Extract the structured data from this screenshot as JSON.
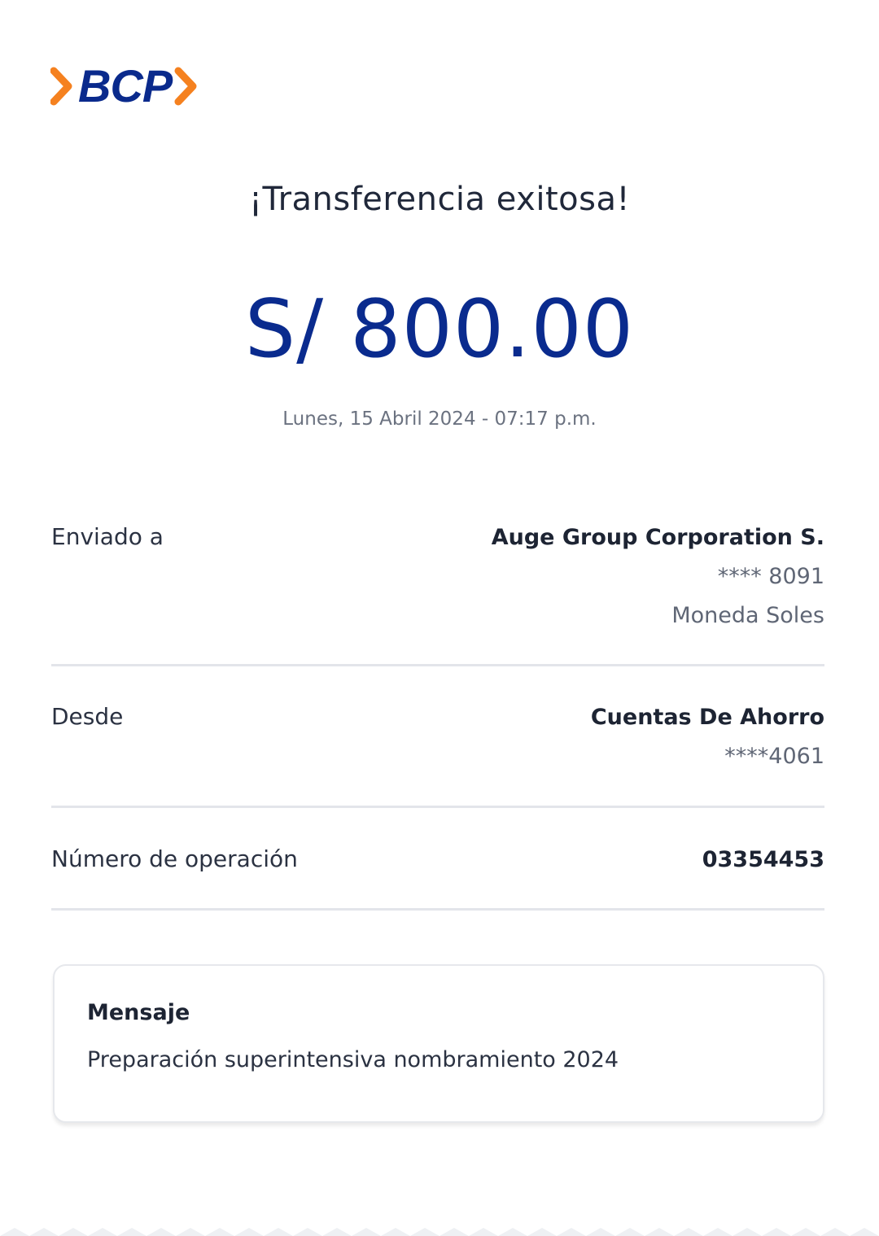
{
  "brand": {
    "name": "BCP",
    "primary_color": "#0a2a8c",
    "accent_color": "#f5811f"
  },
  "header": {
    "title": "¡Transferencia exitosa!"
  },
  "transfer": {
    "amount": "S/ 800.00",
    "datetime": "Lunes, 15 Abril 2024 - 07:17 p.m."
  },
  "sent_to": {
    "label": "Enviado a",
    "name": "Auge Group Corporation S.",
    "account": "**** 8091",
    "currency": "Moneda Soles"
  },
  "from": {
    "label": "Desde",
    "account_type": "Cuentas De Ahorro",
    "account": "****4061"
  },
  "operation": {
    "label": "Número de operación",
    "number": "03354453"
  },
  "message": {
    "title": "Mensaje",
    "text": "Preparación superintensiva nombramiento 2024"
  }
}
